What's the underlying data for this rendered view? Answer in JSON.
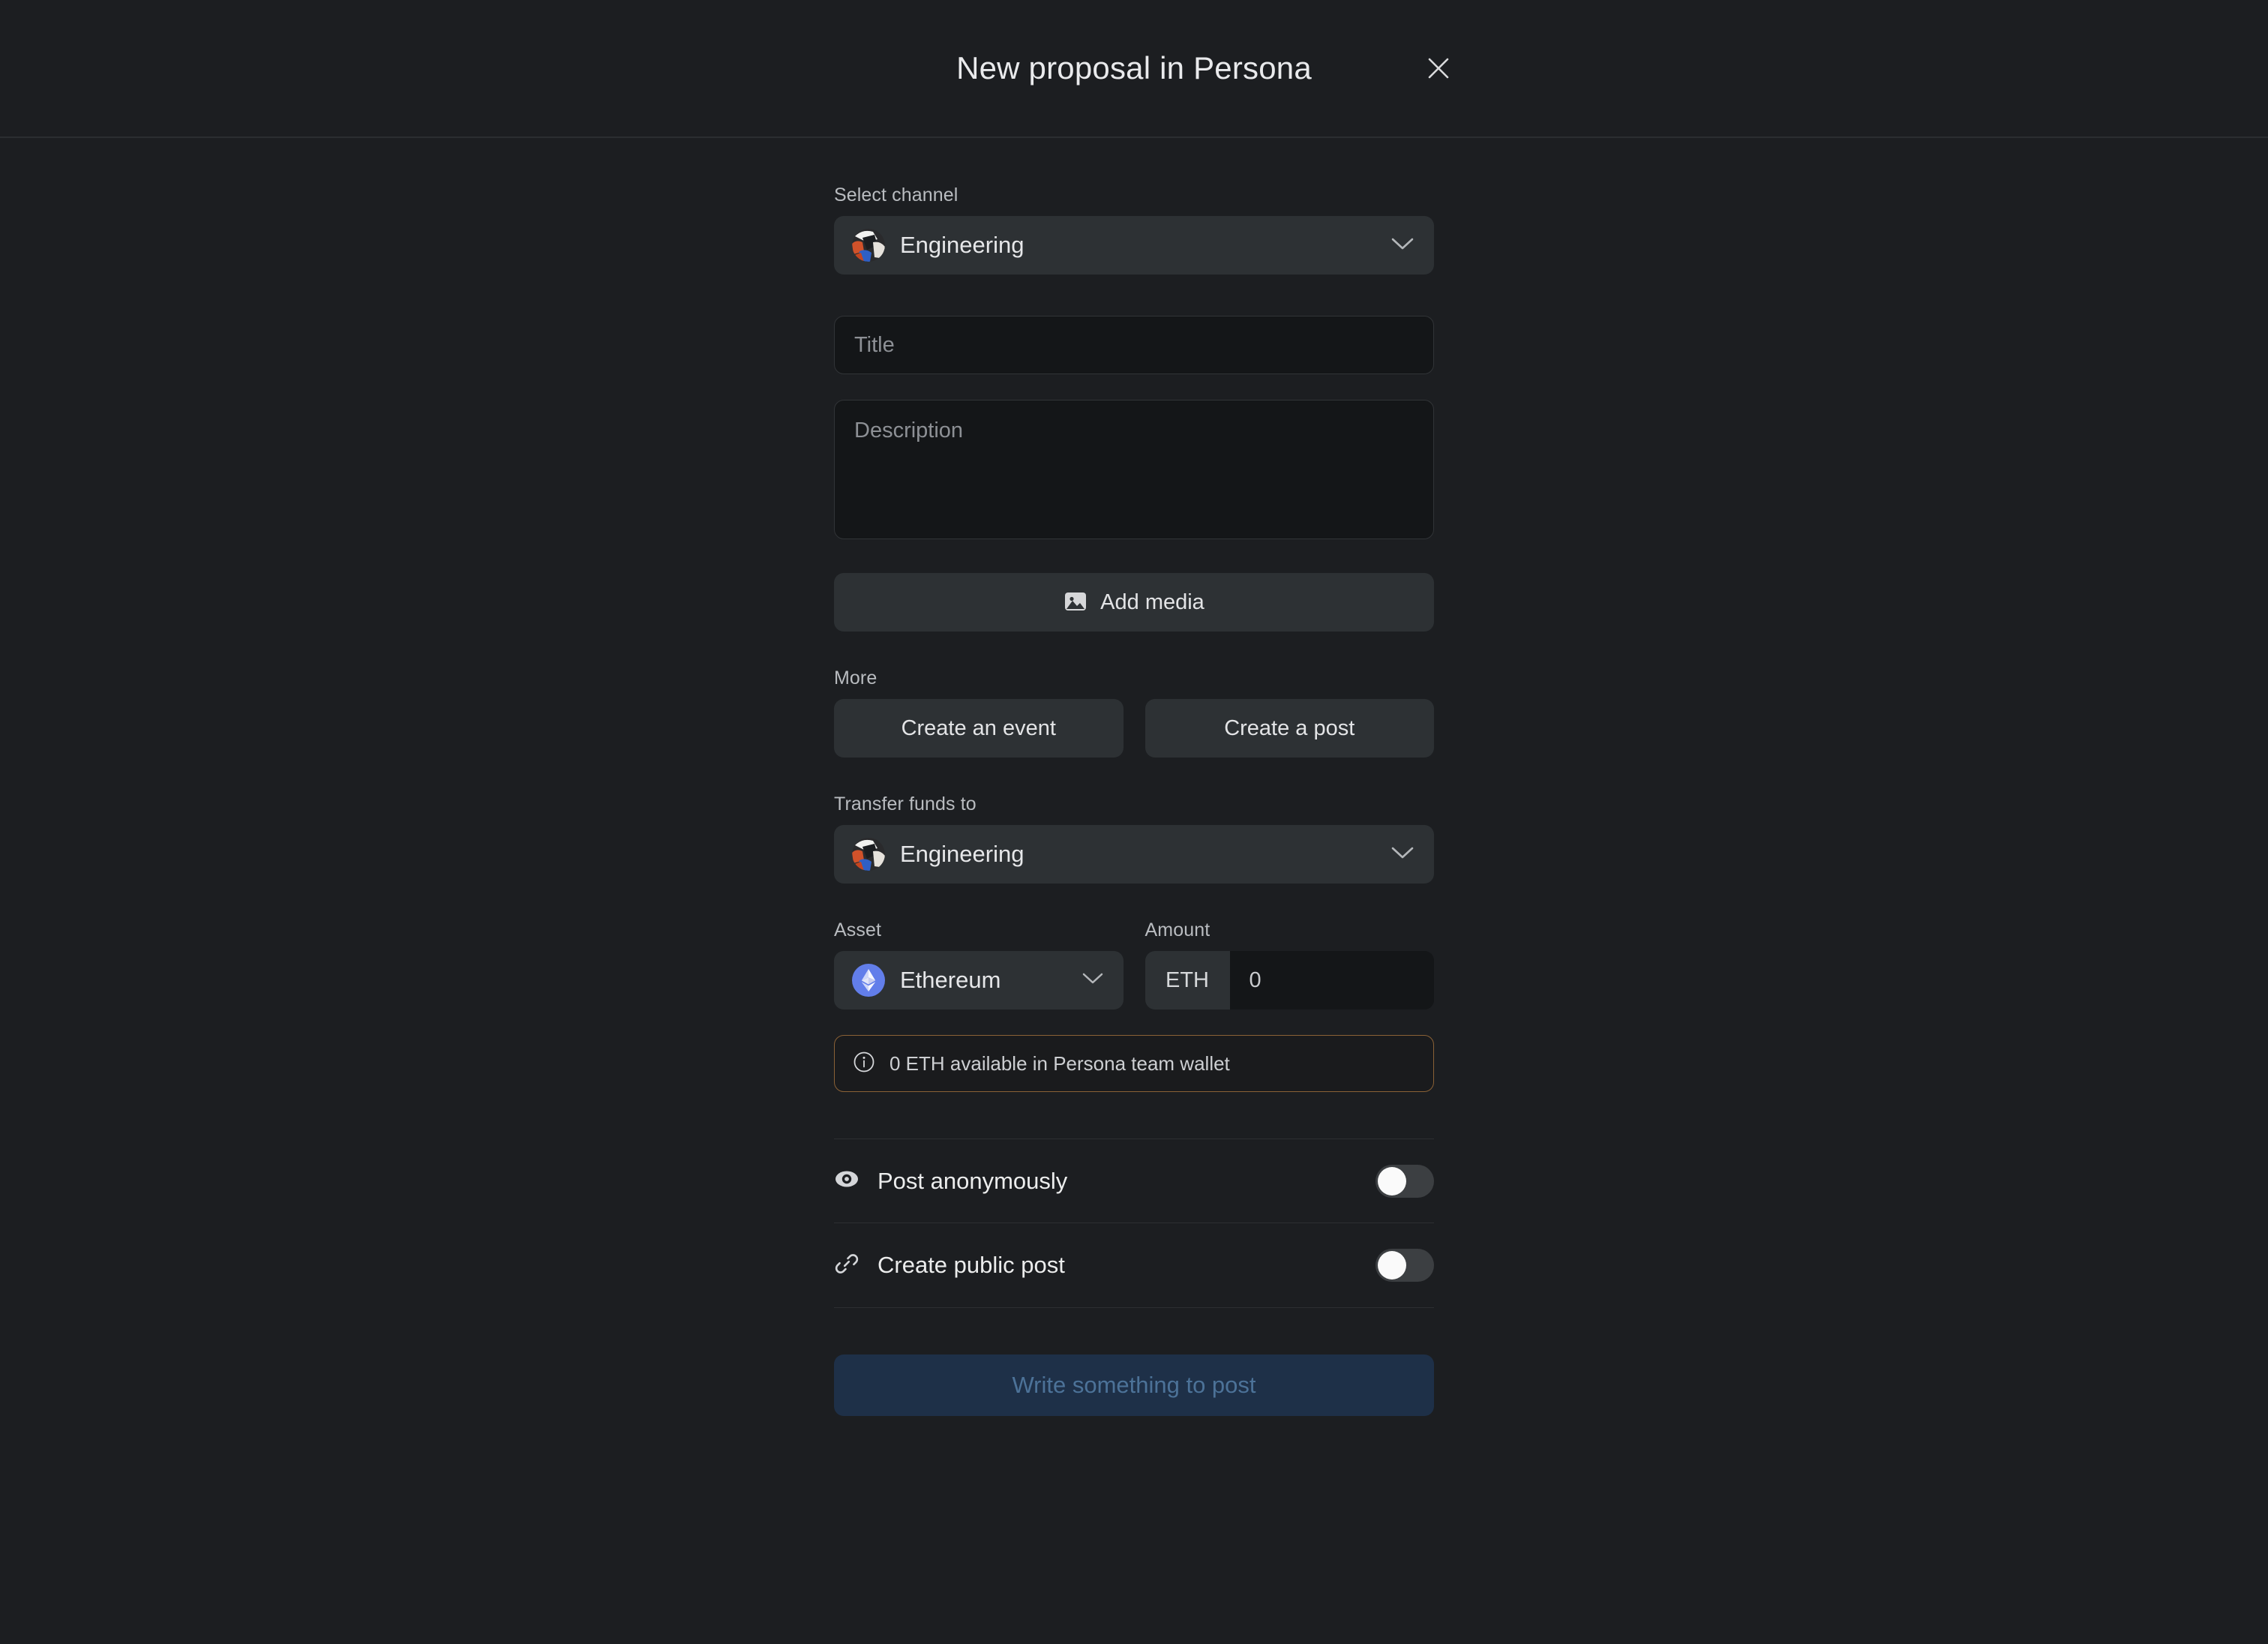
{
  "header": {
    "title": "New proposal in Persona",
    "close_icon": "close-icon"
  },
  "form": {
    "channel": {
      "label": "Select channel",
      "value": "Engineering",
      "avatar_icon": "channel-avatar",
      "chevron_icon": "chevron-down-icon"
    },
    "title_field": {
      "placeholder": "Title",
      "value": ""
    },
    "description_field": {
      "placeholder": "Description",
      "value": ""
    },
    "add_media": {
      "label": "Add media",
      "icon": "image-icon"
    },
    "more": {
      "label": "More",
      "buttons": [
        {
          "label": "Create an event"
        },
        {
          "label": "Create a post"
        }
      ]
    },
    "transfer": {
      "label": "Transfer funds to",
      "value": "Engineering",
      "avatar_icon": "channel-avatar",
      "chevron_icon": "chevron-down-icon"
    },
    "asset": {
      "label": "Asset",
      "value": "Ethereum",
      "icon": "ethereum-icon",
      "chevron_icon": "chevron-down-icon"
    },
    "amount": {
      "label": "Amount",
      "prefix": "ETH",
      "value": "0",
      "placeholder": "0"
    },
    "balance_notice": {
      "text": "0 ETH available in Persona team wallet",
      "icon": "info-icon"
    },
    "options": [
      {
        "label": "Post anonymously",
        "icon": "eye-icon",
        "enabled": false
      },
      {
        "label": "Create public post",
        "icon": "link-icon",
        "enabled": false
      }
    ],
    "submit": {
      "label": "Write something to post",
      "disabled": true
    }
  },
  "colors": {
    "page_background": "#1c1e21",
    "control_background": "#2d3134",
    "input_background": "#141618",
    "notice_border": "#8a6136",
    "submit_background": "#1e3048",
    "submit_text": "#4c7298",
    "ethereum_blue": "#627eea"
  }
}
